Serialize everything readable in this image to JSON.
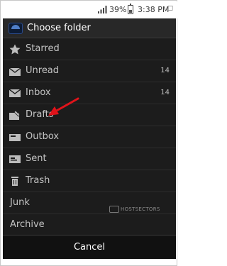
{
  "status_bar": {
    "battery": "39%",
    "time": "3:38 PM"
  },
  "dialog": {
    "title": "Choose folder",
    "icon": "account-logo-icon",
    "folders": [
      {
        "label": "Starred",
        "icon": "star-icon",
        "count": ""
      },
      {
        "label": "Unread",
        "icon": "envelope-open-icon",
        "count": "14"
      },
      {
        "label": "Inbox",
        "icon": "envelope-icon",
        "count": "14"
      },
      {
        "label": "Drafts",
        "icon": "drafts-icon",
        "count": ""
      },
      {
        "label": "Outbox",
        "icon": "outbox-icon",
        "count": ""
      },
      {
        "label": "Sent",
        "icon": "sent-icon",
        "count": ""
      },
      {
        "label": "Trash",
        "icon": "trash-icon",
        "count": ""
      },
      {
        "label": "Junk",
        "icon": "",
        "count": ""
      },
      {
        "label": "Archive",
        "icon": "",
        "count": ""
      }
    ],
    "cancel_label": "Cancel"
  },
  "annotation": {
    "arrow_color": "#e0131a",
    "arrow_target": "Inbox"
  },
  "watermark": {
    "text": "HOSTSECTORS"
  },
  "colors": {
    "dialog_bg": "#1c1c1c",
    "header_bg": "#282828",
    "text": "#c4c4c4",
    "accent_red": "#e0131a"
  }
}
